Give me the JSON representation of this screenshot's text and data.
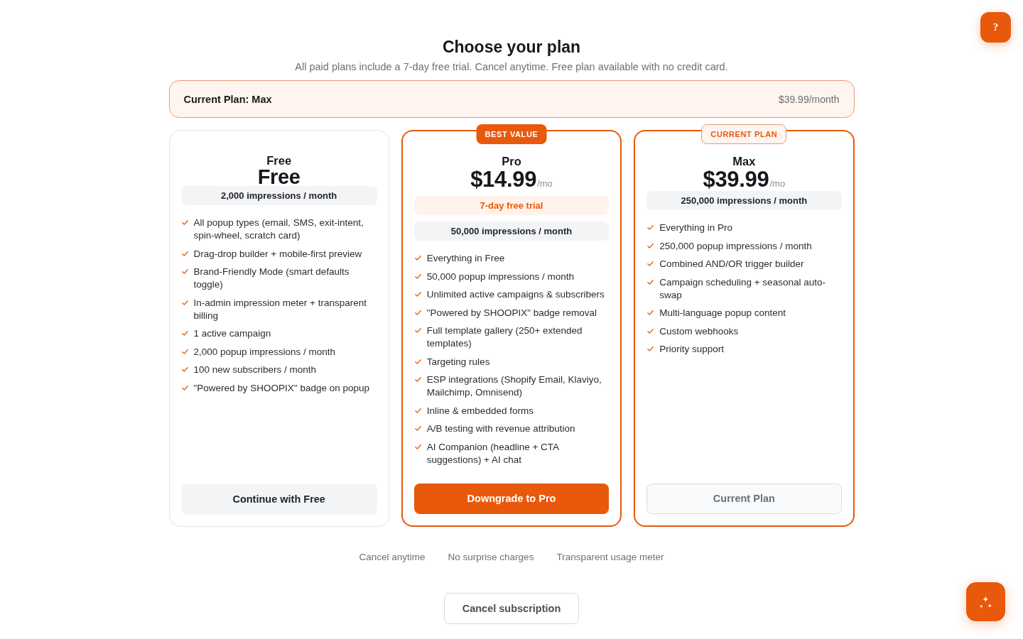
{
  "header": {
    "title": "Choose your plan",
    "subtitle": "All paid plans include a 7-day free trial. Cancel anytime. Free plan available with no credit card."
  },
  "current_plan_banner": {
    "label": "Current Plan: Max",
    "price": "$39.99/month"
  },
  "plans": [
    {
      "name": "Free",
      "price": "Free",
      "highlighted": false,
      "impressions": "2,000 impressions / month",
      "features": [
        "All popup types (email, SMS, exit-intent, spin-wheel, scratch card)",
        "Drag-drop builder + mobile-first preview",
        "Brand-Friendly Mode (smart defaults toggle)",
        "In-admin impression meter + transparent billing",
        "1 active campaign",
        "2,000 popup impressions / month",
        "100 new subscribers / month",
        "\"Powered by SHOOPIX\" badge on popup"
      ],
      "button": {
        "label": "Continue with Free",
        "kind": "secondary",
        "disabled": false
      }
    },
    {
      "name": "Pro",
      "price": "$14.99",
      "price_unit": "/mo",
      "highlighted": true,
      "badge": {
        "label": "BEST VALUE",
        "kind": "filled"
      },
      "trial": "7-day free trial",
      "impressions": "50,000 impressions / month",
      "features": [
        "Everything in Free",
        "50,000 popup impressions / month",
        "Unlimited active campaigns & subscribers",
        "\"Powered by SHOOPIX\" badge removal",
        "Full template gallery (250+ extended templates)",
        "Targeting rules",
        "ESP integrations (Shopify Email, Klaviyo, Mailchimp, Omnisend)",
        "Inline & embedded forms",
        "A/B testing with revenue attribution",
        "AI Companion (headline + CTA suggestions) + AI chat"
      ],
      "button": {
        "label": "Downgrade to Pro",
        "kind": "primary",
        "disabled": false
      }
    },
    {
      "name": "Max",
      "price": "$39.99",
      "price_unit": "/mo",
      "highlighted": true,
      "badge": {
        "label": "CURRENT PLAN",
        "kind": "outline"
      },
      "impressions": "250,000 impressions / month",
      "features": [
        "Everything in Pro",
        "250,000 popup impressions / month",
        "Combined AND/OR trigger builder",
        "Campaign scheduling + seasonal auto-swap",
        "Multi-language popup content",
        "Custom webhooks",
        "Priority support"
      ],
      "button": {
        "label": "Current Plan",
        "kind": "secondary",
        "disabled": true
      }
    }
  ],
  "guarantees": [
    "Cancel anytime",
    "No surprise charges",
    "Transparent usage meter"
  ],
  "cancel_button": {
    "label": "Cancel subscription"
  },
  "help_button": {
    "label": "?"
  }
}
